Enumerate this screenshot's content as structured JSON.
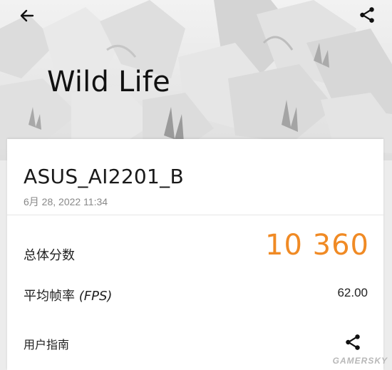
{
  "header": {
    "title": "Wild Life",
    "back_icon": "arrow-left-icon",
    "share_icon": "share-icon"
  },
  "result": {
    "device_name": "ASUS_AI2201_B",
    "date": "6月 28, 2022 11:34",
    "score_label": "总体分数",
    "score_value": "10 360",
    "fps_label": "平均帧率",
    "fps_unit": "(FPS)",
    "fps_value": "62.00",
    "guide_label": "用户指南"
  },
  "colors": {
    "score": "#f08a24",
    "text": "#222222",
    "secondary": "#888888"
  },
  "watermark": "GAMERSKY"
}
